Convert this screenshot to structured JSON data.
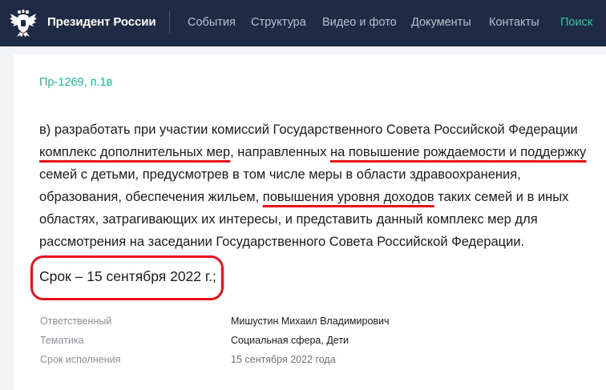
{
  "header": {
    "site_title": "Президент России",
    "nav": [
      "События",
      "Структура",
      "Видео и фото",
      "Документы",
      "Контакты"
    ],
    "search": "Поиск",
    "colors": {
      "background": "#1f2b45",
      "accent": "#34c4a0"
    }
  },
  "document": {
    "reference": "Пр-1269, п.1в",
    "lines": [
      [
        "в) разработать при участии комиссий Государственного Совета Российской Федерации"
      ],
      [
        "комплекс дополнительных мер",
        ", направленных ",
        "на повышение рождаемости и поддержку"
      ],
      [
        "семей с детьми, предусмотрев в том числе меры в области здравоохранения,"
      ],
      [
        "образования, обеспечения жильем, ",
        "повышения уровня доходов",
        " таких семей и в иных"
      ],
      [
        "областях, затрагивающих их интересы, и представить данный комплекс мер для"
      ],
      [
        "рассмотрения на заседании Государственного Совета Российской Федерации."
      ]
    ],
    "deadline": "Срок – 15 сентября 2022 г.;",
    "highlight_color": "#e8101b"
  },
  "meta": {
    "responsible_label": "Ответственный",
    "responsible_value": "Мишустин Михаил Владимирович",
    "topic_label": "Тематика",
    "topic_values": [
      "Социальная сфера",
      "Дети"
    ],
    "topic_separator": ", ",
    "due_label": "Срок исполнения",
    "due_value": "15 сентября 2022 года"
  }
}
